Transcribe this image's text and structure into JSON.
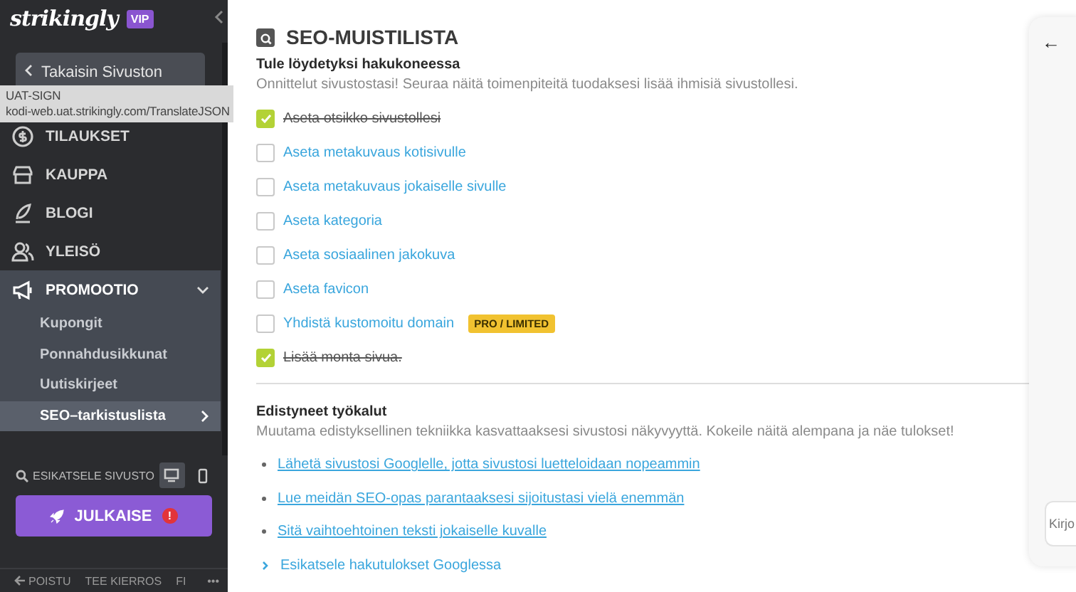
{
  "sidebar": {
    "logo": "strikingly",
    "badge": "VIP",
    "back_button": "Takaisin Sivuston",
    "items": [
      {
        "label": "TILAUKSET"
      },
      {
        "label": "KAUPPA"
      },
      {
        "label": "BLOGI"
      },
      {
        "label": "YLEISÖ"
      },
      {
        "label": "PROMOOTIO",
        "expanded": true,
        "children": [
          {
            "label": "Kupongit",
            "selected": false
          },
          {
            "label": "Ponnahdusikkunat",
            "selected": false
          },
          {
            "label": "Uutiskirjeet",
            "selected": false
          },
          {
            "label": "SEO–tarkistuslista",
            "selected": true
          }
        ]
      }
    ],
    "preview": "ESIKATSELE SIVUSTO",
    "devices": [
      {
        "selected": true
      },
      {
        "selected": false
      }
    ],
    "publish": "JULKAISE",
    "publish_alert": "!",
    "footer": [
      "POISTU",
      "TEE KIERROS",
      "FI",
      "•••"
    ]
  },
  "tooltip": {
    "title": "UAT-SIGN",
    "url": "kodi-web.uat.strikingly.com/TranslateJSON"
  },
  "main": {
    "title": "SEO-MUISTILISTA",
    "sections": [
      {
        "heading": "Tule löydetyksi hakukoneessa",
        "description": "Onnittelut sivustostasi! Seuraa näitä toimenpiteitä tuodaksesi lisää ihmisiä sivustollesi.",
        "checklist": [
          {
            "label": "Aseta otsikko sivustollesi",
            "checked": true
          },
          {
            "label": "Aseta metakuvaus kotisivulle",
            "checked": false
          },
          {
            "label": "Aseta metakuvaus jokaiselle sivulle",
            "checked": false
          },
          {
            "label": "Aseta kategoria",
            "checked": false
          },
          {
            "label": "Aseta sosiaalinen jakokuva",
            "checked": false
          },
          {
            "label": "Aseta favicon",
            "checked": false
          },
          {
            "label": "Yhdistä kustomoitu domain",
            "checked": false,
            "badge": "PRO / LIMITED"
          },
          {
            "label": "Lisää monta sivua.",
            "checked": true
          }
        ]
      },
      {
        "heading": "Edistyneet työkalut",
        "description": "Muutama edistyksellinen tekniikka kasvattaaksesi sivustosi näkyvyyttä. Kokeile näitä alempana ja näe tulokset!",
        "links": [
          {
            "label": "Lähetä sivustosi Googlelle, jotta sivustosi luetteloidaan nopeammin",
            "kind": "bullet"
          },
          {
            "label": "Lue meidän SEO-opas parantaaksesi sijoitustasi vielä enemmän",
            "kind": "bullet"
          },
          {
            "label": "Sitä vaihtoehtoinen teksti jokaiselle kuvalle",
            "kind": "bullet"
          },
          {
            "label": "Esikatsele hakutulokset Googlessa",
            "kind": "expander"
          }
        ]
      }
    ]
  },
  "panel": {
    "back": "←",
    "placeholder": "Kirjo"
  }
}
